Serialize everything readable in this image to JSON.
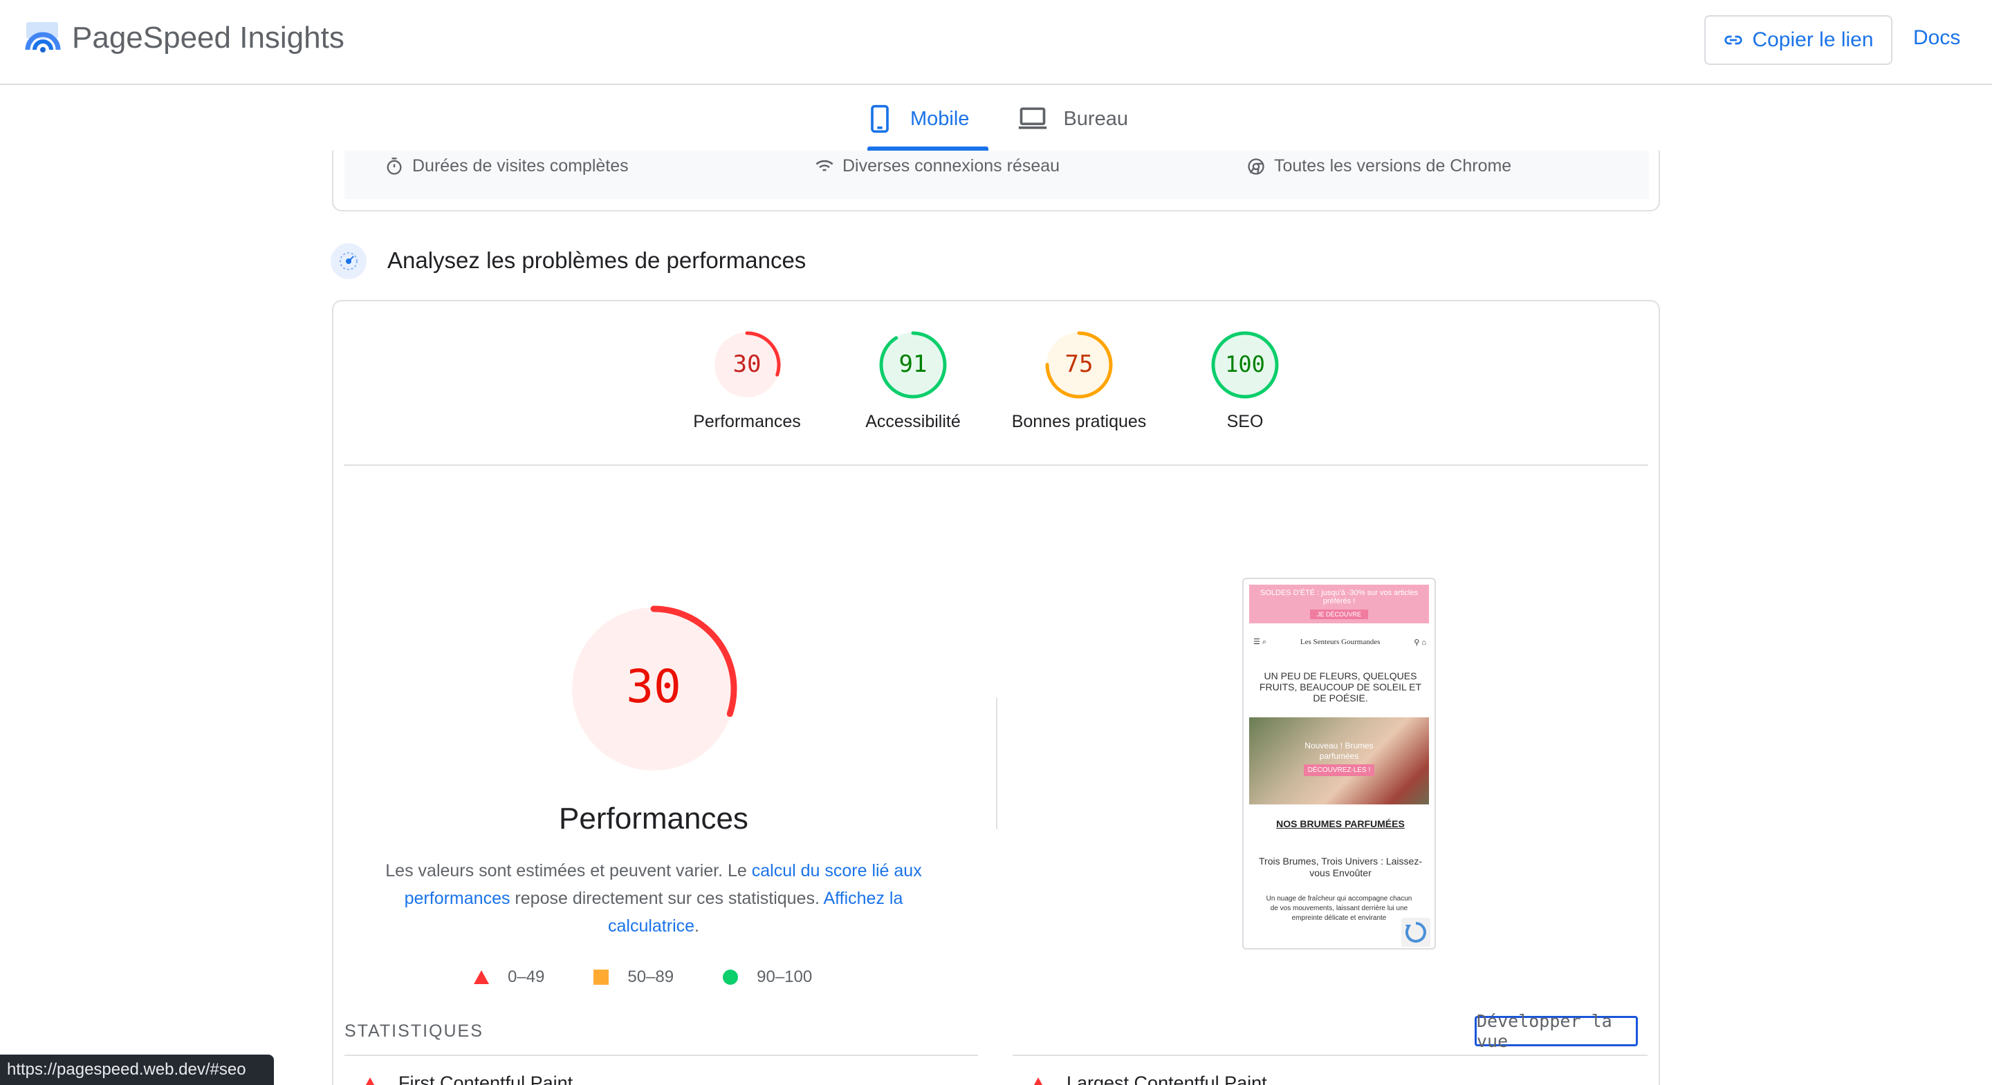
{
  "app": {
    "title": "PageSpeed Insights"
  },
  "header": {
    "copy_link_label": "Copier le lien",
    "docs_label": "Docs"
  },
  "tabs": [
    {
      "label": "Mobile",
      "icon": "smartphone-icon",
      "active": true
    },
    {
      "label": "Bureau",
      "icon": "laptop-icon",
      "active": false
    }
  ],
  "environment": {
    "items": [
      {
        "label": "Durées de visites complètes",
        "icon": "timer-icon"
      },
      {
        "label": "Diverses connexions réseau",
        "icon": "network-icon"
      },
      {
        "label": "Toutes les versions de Chrome",
        "icon": "chrome-icon"
      }
    ]
  },
  "section": {
    "title": "Analysez les problèmes de performances"
  },
  "categories": [
    {
      "score": "30",
      "label": "Performances",
      "status": "fail",
      "fraction": 0.3
    },
    {
      "score": "91",
      "label": "Accessibilité",
      "status": "pass",
      "fraction": 0.91
    },
    {
      "score": "75",
      "label": "Bonnes pratiques",
      "status": "average",
      "fraction": 0.75
    },
    {
      "score": "100",
      "label": "SEO",
      "status": "pass",
      "fraction": 1.0
    }
  ],
  "performance": {
    "score": "30",
    "title": "Performances",
    "desc_1": "Les valeurs sont estimées et peuvent varier. Le ",
    "desc_link_1": "calcul du score lié aux performances",
    "desc_2": " repose directement sur ces statistiques. ",
    "desc_link_2": "Affichez la calculatrice",
    "desc_3": "."
  },
  "legend": [
    {
      "range": "0–49",
      "shape": "triangle",
      "color": "#ff3333"
    },
    {
      "range": "50–89",
      "shape": "square",
      "color": "#ffaa33"
    },
    {
      "range": "90–100",
      "shape": "circle",
      "color": "#0cce6b"
    }
  ],
  "screenshot": {
    "banner": "SOLDES D'ÉTÉ : jusqu'à -30% sur vos articles préférés !",
    "banner_button": "JE DÉCOUVRE",
    "brand": "Les Senteurs Gourmandes",
    "headline": "UN PEU DE FLEURS, QUELQUES FRUITS, BEAUCOUP DE SOLEIL ET DE POÉSIE.",
    "hero_caption": "Nouveau ! Brumes parfumées",
    "hero_button": "DÉCOUVREZ-LES !",
    "subtitle": "NOS BRUMES PARFUMÉES",
    "subtitle2": "Trois Brumes, Trois Univers : Laissez-vous Envoûter",
    "body": "Un nuage de fraîcheur qui accompagne chacun de vos mouvements, laissant derrière lui une empreinte délicate et envirante"
  },
  "stats": {
    "title": "STATISTIQUES",
    "expand_label": "Développer la vue",
    "metrics": [
      {
        "label": "First Contentful Paint",
        "status": "fail"
      },
      {
        "label": "Largest Contentful Paint",
        "status": "fail"
      }
    ]
  },
  "status_bar": {
    "url": "https://pagespeed.web.dev/#seo"
  },
  "colors": {
    "fail": "#ff3333",
    "average": "#ffa400",
    "pass": "#0cce6b",
    "accent": "#1a73e8"
  }
}
